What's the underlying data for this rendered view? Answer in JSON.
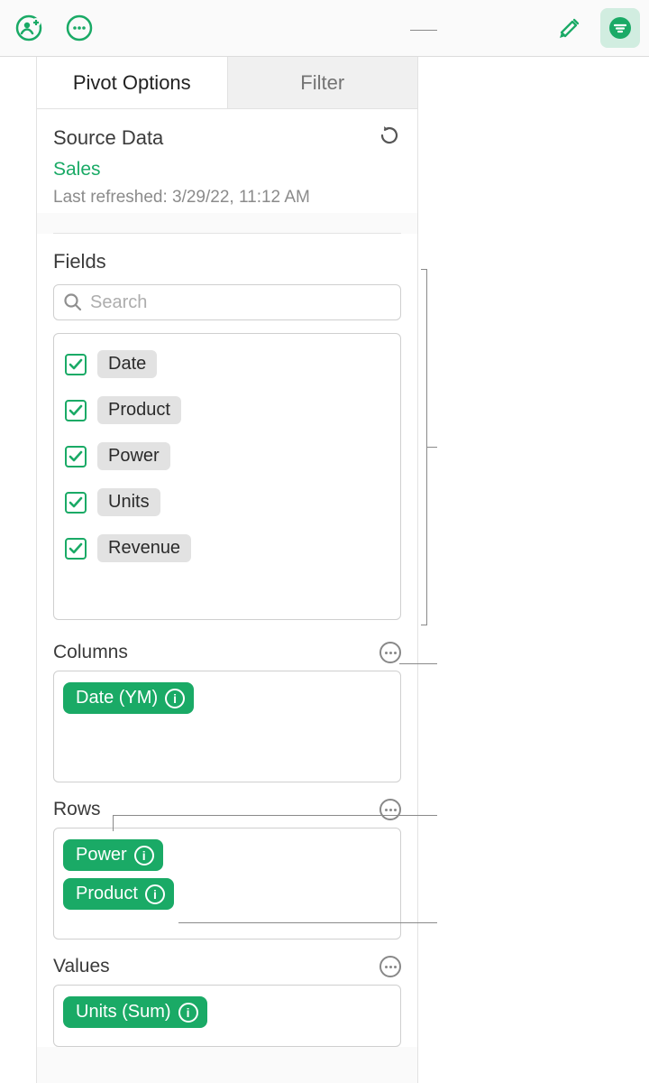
{
  "toolbar": {
    "collab_icon": "collaborator-add-icon",
    "more_icon": "more-icon",
    "format_icon": "format-brush-icon",
    "organize_icon": "organize-icon"
  },
  "tabs": {
    "pivot": "Pivot Options",
    "filter": "Filter"
  },
  "source": {
    "heading": "Source Data",
    "name": "Sales",
    "refreshed": "Last refreshed: 3/29/22, 11:12 AM"
  },
  "fields": {
    "heading": "Fields",
    "search_placeholder": "Search",
    "items": [
      {
        "label": "Date",
        "checked": true
      },
      {
        "label": "Product",
        "checked": true
      },
      {
        "label": "Power",
        "checked": true
      },
      {
        "label": "Units",
        "checked": true
      },
      {
        "label": "Revenue",
        "checked": true
      }
    ]
  },
  "columns": {
    "heading": "Columns",
    "items": [
      {
        "label": "Date (YM)"
      }
    ]
  },
  "rows": {
    "heading": "Rows",
    "items": [
      {
        "label": "Power"
      },
      {
        "label": "Product"
      }
    ]
  },
  "values": {
    "heading": "Values",
    "items": [
      {
        "label": "Units (Sum)"
      }
    ]
  }
}
